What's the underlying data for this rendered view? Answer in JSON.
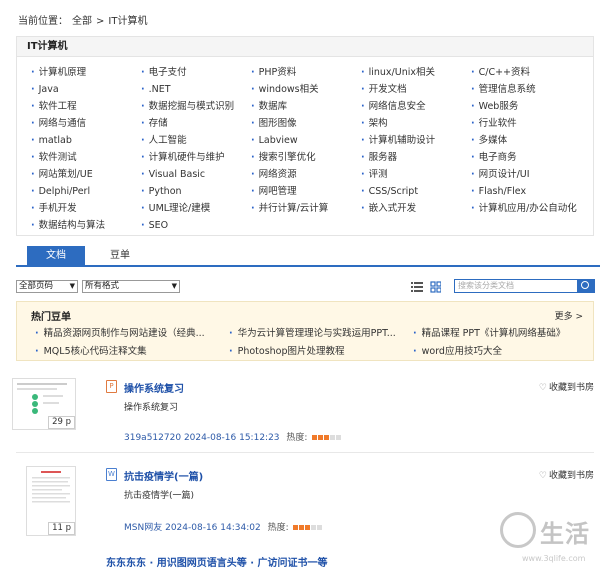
{
  "breadcrumb": {
    "prefix": "当前位置：",
    "root": "全部",
    "sep": ">",
    "current": "IT计算机"
  },
  "categories": {
    "title": "IT计算机",
    "items": [
      "计算机原理",
      "电子支付",
      "PHP资料",
      "linux/Unix相关",
      "C/C++资料",
      "Java",
      ".NET",
      "windows相关",
      "开发文档",
      "管理信息系统",
      "软件工程",
      "数据挖掘与模式识别",
      "数据库",
      "网络信息安全",
      "Web服务",
      "网络与通信",
      "存储",
      "图形图像",
      "架构",
      "行业软件",
      "matlab",
      "人工智能",
      "Labview",
      "计算机辅助设计",
      "多媒体",
      "软件测试",
      "计算机硬件与维护",
      "搜索引擎优化",
      "服务器",
      "电子商务",
      "网站策划/UE",
      "Visual Basic",
      "网络资源",
      "评测",
      "网页设计/UI",
      "Delphi/Perl",
      "Python",
      "网吧管理",
      "CSS/Script",
      "Flash/Flex",
      "手机开发",
      "UML理论/建模",
      "并行计算/云计算",
      "嵌入式开发",
      "计算机应用/办公自动化",
      "数据结构与算法",
      "SEO"
    ]
  },
  "tabs": {
    "docs": "文档",
    "lists": "豆单"
  },
  "filters": {
    "pages": "全部页码",
    "format": "所有格式"
  },
  "search": {
    "placeholder": "搜索该分类文档"
  },
  "hot": {
    "title": "热门豆单",
    "more": "更多 >",
    "links": [
      "精品资源网页制作与网站建设（经典...",
      "华为云计算管理理论与实践运用PPT...",
      "精品课程 PPT《计算机网络基础》",
      "MQL5核心代码注释文集",
      "Photoshop图片处理教程",
      "word应用技巧大全"
    ]
  },
  "docs": [
    {
      "title": "操作系统复习",
      "desc": "操作系统复习",
      "author": "319a512720",
      "date": "2024-08-16 15:12:23",
      "heat_label": "热度:",
      "heat": 3,
      "pages": "29 p",
      "fav": "收藏到书房",
      "type": "P"
    },
    {
      "title": "抗击疫情学(一篇)",
      "desc": "抗击疫情学(一篇)",
      "author": "MSN网友",
      "date": "2024-08-16 14:34:02",
      "heat_label": "热度:",
      "heat": 3,
      "pages": "11 p",
      "fav": "收藏到书房",
      "type": "W"
    }
  ],
  "next_doc": "东东东东 · 用识图网页语言头等 · 广访问证书一等",
  "watermark": {
    "text": "生活",
    "url": "www.3qlife.com"
  }
}
